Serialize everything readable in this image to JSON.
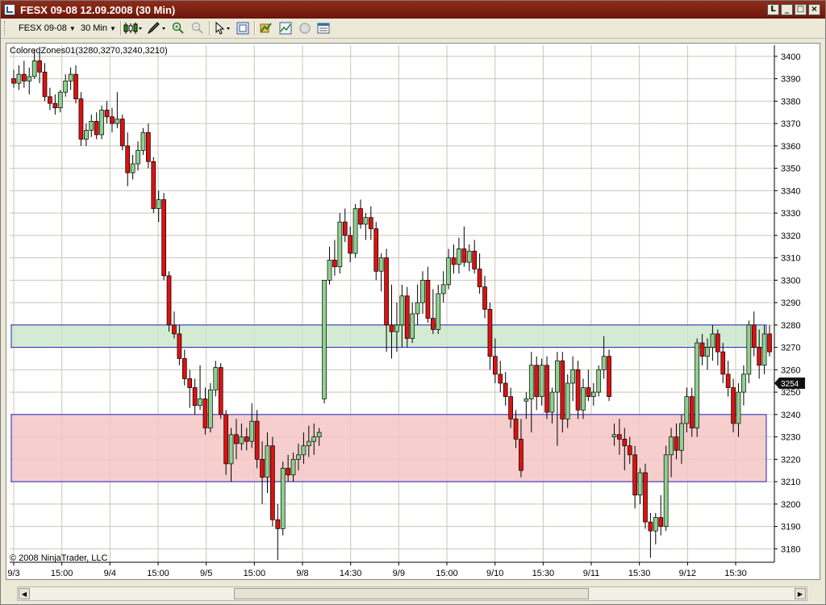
{
  "window": {
    "title": "FESX 09-08  12.09.2008 (30 Min)"
  },
  "toolbar": {
    "instrument": "FESX 09-08",
    "interval": "30 Min"
  },
  "chart": {
    "indicator_label": "ColoredZones01(3280,3270,3240,3210)",
    "copyright": "© 2008 NinjaTrader, LLC",
    "last_price_label": "3254",
    "colors": {
      "up_body": "#8fd18f",
      "down_body": "#dd1111",
      "upper_zone_fill": "#cbe8cb",
      "lower_zone_fill": "#f5c6c6",
      "zone_border": "#2222bb",
      "gridline": "#c9c4b4"
    }
  },
  "chart_data": {
    "type": "candlestick",
    "title": "",
    "ylim": [
      3174,
      3405
    ],
    "y_ticks": [
      3180,
      3190,
      3200,
      3210,
      3220,
      3230,
      3240,
      3250,
      3260,
      3270,
      3280,
      3290,
      3300,
      3310,
      3320,
      3330,
      3340,
      3350,
      3360,
      3370,
      3380,
      3390,
      3400
    ],
    "x_tick_labels": [
      "9/3",
      "15:00",
      "9/4",
      "15:00",
      "9/5",
      "15:00",
      "9/8",
      "14:30",
      "9/9",
      "15:00",
      "9/10",
      "15:30",
      "9/11",
      "15:30",
      "9/12",
      "15:30"
    ],
    "zones": [
      {
        "high": 3280,
        "low": 3270
      },
      {
        "high": 3240,
        "low": 3210
      }
    ],
    "last_price": 3254,
    "candles": [
      {
        "o": 3390,
        "h": 3394,
        "l": 3386,
        "c": 3388
      },
      {
        "o": 3388,
        "h": 3396,
        "l": 3385,
        "c": 3392
      },
      {
        "o": 3392,
        "h": 3398,
        "l": 3386,
        "c": 3389
      },
      {
        "o": 3389,
        "h": 3395,
        "l": 3383,
        "c": 3391
      },
      {
        "o": 3391,
        "h": 3403,
        "l": 3390,
        "c": 3398
      },
      {
        "o": 3398,
        "h": 3402,
        "l": 3388,
        "c": 3393
      },
      {
        "o": 3393,
        "h": 3397,
        "l": 3380,
        "c": 3382
      },
      {
        "o": 3382,
        "h": 3386,
        "l": 3376,
        "c": 3379
      },
      {
        "o": 3379,
        "h": 3383,
        "l": 3374,
        "c": 3377
      },
      {
        "o": 3377,
        "h": 3385,
        "l": 3375,
        "c": 3384
      },
      {
        "o": 3384,
        "h": 3392,
        "l": 3382,
        "c": 3389
      },
      {
        "o": 3389,
        "h": 3395,
        "l": 3385,
        "c": 3392
      },
      {
        "o": 3392,
        "h": 3396,
        "l": 3379,
        "c": 3381
      },
      {
        "o": 3381,
        "h": 3384,
        "l": 3360,
        "c": 3363
      },
      {
        "o": 3363,
        "h": 3370,
        "l": 3360,
        "c": 3367
      },
      {
        "o": 3367,
        "h": 3374,
        "l": 3364,
        "c": 3371
      },
      {
        "o": 3371,
        "h": 3375,
        "l": 3363,
        "c": 3365
      },
      {
        "o": 3365,
        "h": 3378,
        "l": 3363,
        "c": 3376
      },
      {
        "o": 3376,
        "h": 3380,
        "l": 3370,
        "c": 3373
      },
      {
        "o": 3373,
        "h": 3377,
        "l": 3366,
        "c": 3370
      },
      {
        "o": 3370,
        "h": 3384,
        "l": 3368,
        "c": 3372
      },
      {
        "o": 3372,
        "h": 3374,
        "l": 3358,
        "c": 3360
      },
      {
        "o": 3360,
        "h": 3366,
        "l": 3342,
        "c": 3348
      },
      {
        "o": 3348,
        "h": 3356,
        "l": 3345,
        "c": 3352
      },
      {
        "o": 3352,
        "h": 3362,
        "l": 3349,
        "c": 3358
      },
      {
        "o": 3358,
        "h": 3368,
        "l": 3356,
        "c": 3366
      },
      {
        "o": 3366,
        "h": 3370,
        "l": 3350,
        "c": 3353
      },
      {
        "o": 3353,
        "h": 3355,
        "l": 3330,
        "c": 3332
      },
      {
        "o": 3332,
        "h": 3340,
        "l": 3326,
        "c": 3336
      },
      {
        "o": 3336,
        "h": 3339,
        "l": 3300,
        "c": 3302
      },
      {
        "o": 3302,
        "h": 3304,
        "l": 3277,
        "c": 3280
      },
      {
        "o": 3280,
        "h": 3286,
        "l": 3274,
        "c": 3276
      },
      {
        "o": 3276,
        "h": 3280,
        "l": 3262,
        "c": 3265
      },
      {
        "o": 3265,
        "h": 3269,
        "l": 3253,
        "c": 3256
      },
      {
        "o": 3256,
        "h": 3260,
        "l": 3243,
        "c": 3252
      },
      {
        "o": 3252,
        "h": 3256,
        "l": 3240,
        "c": 3244
      },
      {
        "o": 3244,
        "h": 3262,
        "l": 3242,
        "c": 3247
      },
      {
        "o": 3247,
        "h": 3252,
        "l": 3231,
        "c": 3234
      },
      {
        "o": 3234,
        "h": 3254,
        "l": 3232,
        "c": 3251
      },
      {
        "o": 3251,
        "h": 3264,
        "l": 3248,
        "c": 3261
      },
      {
        "o": 3261,
        "h": 3263,
        "l": 3238,
        "c": 3240
      },
      {
        "o": 3240,
        "h": 3242,
        "l": 3213,
        "c": 3218
      },
      {
        "o": 3218,
        "h": 3234,
        "l": 3210,
        "c": 3231
      },
      {
        "o": 3231,
        "h": 3238,
        "l": 3220,
        "c": 3227
      },
      {
        "o": 3227,
        "h": 3236,
        "l": 3224,
        "c": 3230
      },
      {
        "o": 3230,
        "h": 3234,
        "l": 3224,
        "c": 3228
      },
      {
        "o": 3228,
        "h": 3245,
        "l": 3225,
        "c": 3237
      },
      {
        "o": 3237,
        "h": 3242,
        "l": 3216,
        "c": 3220
      },
      {
        "o": 3220,
        "h": 3228,
        "l": 3200,
        "c": 3212
      },
      {
        "o": 3212,
        "h": 3232,
        "l": 3205,
        "c": 3226
      },
      {
        "o": 3226,
        "h": 3230,
        "l": 3190,
        "c": 3193
      },
      {
        "o": 3193,
        "h": 3200,
        "l": 3175,
        "c": 3189
      },
      {
        "o": 3189,
        "h": 3219,
        "l": 3186,
        "c": 3216
      },
      {
        "o": 3216,
        "h": 3222,
        "l": 3210,
        "c": 3213
      },
      {
        "o": 3213,
        "h": 3223,
        "l": 3210,
        "c": 3220
      },
      {
        "o": 3220,
        "h": 3227,
        "l": 3215,
        "c": 3222
      },
      {
        "o": 3222,
        "h": 3232,
        "l": 3218,
        "c": 3226
      },
      {
        "o": 3226,
        "h": 3235,
        "l": 3221,
        "c": 3228
      },
      {
        "o": 3228,
        "h": 3236,
        "l": 3222,
        "c": 3230
      },
      {
        "o": 3230,
        "h": 3234,
        "l": 3226,
        "c": 3232
      },
      {
        "o": 3247,
        "h": 3300,
        "l": 3245,
        "c": 3300
      },
      {
        "o": 3300,
        "h": 3315,
        "l": 3298,
        "c": 3309
      },
      {
        "o": 3309,
        "h": 3318,
        "l": 3302,
        "c": 3306
      },
      {
        "o": 3306,
        "h": 3330,
        "l": 3303,
        "c": 3326
      },
      {
        "o": 3326,
        "h": 3332,
        "l": 3317,
        "c": 3320
      },
      {
        "o": 3320,
        "h": 3324,
        "l": 3308,
        "c": 3312
      },
      {
        "o": 3312,
        "h": 3334,
        "l": 3310,
        "c": 3332
      },
      {
        "o": 3332,
        "h": 3336,
        "l": 3323,
        "c": 3325
      },
      {
        "o": 3325,
        "h": 3330,
        "l": 3318,
        "c": 3328
      },
      {
        "o": 3328,
        "h": 3333,
        "l": 3318,
        "c": 3323
      },
      {
        "o": 3323,
        "h": 3326,
        "l": 3300,
        "c": 3304
      },
      {
        "o": 3304,
        "h": 3312,
        "l": 3295,
        "c": 3310
      },
      {
        "o": 3310,
        "h": 3314,
        "l": 3268,
        "c": 3280
      },
      {
        "o": 3280,
        "h": 3298,
        "l": 3265,
        "c": 3277
      },
      {
        "o": 3277,
        "h": 3290,
        "l": 3268,
        "c": 3280
      },
      {
        "o": 3280,
        "h": 3298,
        "l": 3270,
        "c": 3293
      },
      {
        "o": 3293,
        "h": 3297,
        "l": 3270,
        "c": 3274
      },
      {
        "o": 3274,
        "h": 3290,
        "l": 3272,
        "c": 3285
      },
      {
        "o": 3285,
        "h": 3298,
        "l": 3280,
        "c": 3290
      },
      {
        "o": 3290,
        "h": 3304,
        "l": 3285,
        "c": 3300
      },
      {
        "o": 3300,
        "h": 3306,
        "l": 3281,
        "c": 3283
      },
      {
        "o": 3283,
        "h": 3296,
        "l": 3276,
        "c": 3278
      },
      {
        "o": 3278,
        "h": 3298,
        "l": 3276,
        "c": 3294
      },
      {
        "o": 3294,
        "h": 3304,
        "l": 3290,
        "c": 3298
      },
      {
        "o": 3298,
        "h": 3314,
        "l": 3296,
        "c": 3310
      },
      {
        "o": 3310,
        "h": 3316,
        "l": 3303,
        "c": 3307
      },
      {
        "o": 3307,
        "h": 3319,
        "l": 3303,
        "c": 3314
      },
      {
        "o": 3314,
        "h": 3324,
        "l": 3306,
        "c": 3308
      },
      {
        "o": 3308,
        "h": 3316,
        "l": 3304,
        "c": 3313
      },
      {
        "o": 3313,
        "h": 3318,
        "l": 3303,
        "c": 3305
      },
      {
        "o": 3305,
        "h": 3312,
        "l": 3294,
        "c": 3297
      },
      {
        "o": 3297,
        "h": 3302,
        "l": 3283,
        "c": 3287
      },
      {
        "o": 3287,
        "h": 3290,
        "l": 3260,
        "c": 3266
      },
      {
        "o": 3266,
        "h": 3274,
        "l": 3254,
        "c": 3258
      },
      {
        "o": 3258,
        "h": 3264,
        "l": 3250,
        "c": 3254
      },
      {
        "o": 3254,
        "h": 3259,
        "l": 3244,
        "c": 3248
      },
      {
        "o": 3248,
        "h": 3252,
        "l": 3234,
        "c": 3238
      },
      {
        "o": 3238,
        "h": 3242,
        "l": 3225,
        "c": 3229
      },
      {
        "o": 3229,
        "h": 3238,
        "l": 3212,
        "c": 3215
      },
      {
        "o": 3246,
        "h": 3250,
        "l": 3238,
        "c": 3247
      },
      {
        "o": 3247,
        "h": 3268,
        "l": 3232,
        "c": 3262
      },
      {
        "o": 3262,
        "h": 3266,
        "l": 3242,
        "c": 3248
      },
      {
        "o": 3248,
        "h": 3265,
        "l": 3244,
        "c": 3262
      },
      {
        "o": 3262,
        "h": 3266,
        "l": 3238,
        "c": 3241
      },
      {
        "o": 3241,
        "h": 3252,
        "l": 3236,
        "c": 3250
      },
      {
        "o": 3250,
        "h": 3268,
        "l": 3226,
        "c": 3264
      },
      {
        "o": 3264,
        "h": 3268,
        "l": 3232,
        "c": 3238
      },
      {
        "o": 3238,
        "h": 3258,
        "l": 3234,
        "c": 3254
      },
      {
        "o": 3254,
        "h": 3266,
        "l": 3246,
        "c": 3260
      },
      {
        "o": 3260,
        "h": 3264,
        "l": 3238,
        "c": 3242
      },
      {
        "o": 3242,
        "h": 3256,
        "l": 3238,
        "c": 3252
      },
      {
        "o": 3252,
        "h": 3260,
        "l": 3246,
        "c": 3248
      },
      {
        "o": 3248,
        "h": 3254,
        "l": 3244,
        "c": 3250
      },
      {
        "o": 3250,
        "h": 3262,
        "l": 3248,
        "c": 3260
      },
      {
        "o": 3260,
        "h": 3275,
        "l": 3256,
        "c": 3266
      },
      {
        "o": 3266,
        "h": 3269,
        "l": 3246,
        "c": 3248
      },
      {
        "o": 3230,
        "h": 3236,
        "l": 3226,
        "c": 3231
      },
      {
        "o": 3231,
        "h": 3238,
        "l": 3222,
        "c": 3229
      },
      {
        "o": 3229,
        "h": 3234,
        "l": 3215,
        "c": 3226
      },
      {
        "o": 3226,
        "h": 3230,
        "l": 3218,
        "c": 3222
      },
      {
        "o": 3222,
        "h": 3226,
        "l": 3198,
        "c": 3204
      },
      {
        "o": 3204,
        "h": 3216,
        "l": 3200,
        "c": 3214
      },
      {
        "o": 3214,
        "h": 3218,
        "l": 3189,
        "c": 3192
      },
      {
        "o": 3192,
        "h": 3196,
        "l": 3176,
        "c": 3188
      },
      {
        "o": 3188,
        "h": 3196,
        "l": 3182,
        "c": 3194
      },
      {
        "o": 3194,
        "h": 3204,
        "l": 3186,
        "c": 3190
      },
      {
        "o": 3190,
        "h": 3226,
        "l": 3188,
        "c": 3222
      },
      {
        "o": 3222,
        "h": 3234,
        "l": 3212,
        "c": 3230
      },
      {
        "o": 3230,
        "h": 3236,
        "l": 3220,
        "c": 3224
      },
      {
        "o": 3224,
        "h": 3240,
        "l": 3218,
        "c": 3236
      },
      {
        "o": 3236,
        "h": 3252,
        "l": 3232,
        "c": 3248
      },
      {
        "o": 3248,
        "h": 3252,
        "l": 3230,
        "c": 3234
      },
      {
        "o": 3234,
        "h": 3274,
        "l": 3230,
        "c": 3272
      },
      {
        "o": 3272,
        "h": 3276,
        "l": 3262,
        "c": 3266
      },
      {
        "o": 3266,
        "h": 3274,
        "l": 3260,
        "c": 3270
      },
      {
        "o": 3270,
        "h": 3280,
        "l": 3264,
        "c": 3276
      },
      {
        "o": 3276,
        "h": 3278,
        "l": 3262,
        "c": 3268
      },
      {
        "o": 3268,
        "h": 3272,
        "l": 3254,
        "c": 3258
      },
      {
        "o": 3258,
        "h": 3264,
        "l": 3248,
        "c": 3252
      },
      {
        "o": 3252,
        "h": 3256,
        "l": 3232,
        "c": 3236
      },
      {
        "o": 3236,
        "h": 3254,
        "l": 3230,
        "c": 3250
      },
      {
        "o": 3250,
        "h": 3262,
        "l": 3244,
        "c": 3258
      },
      {
        "o": 3258,
        "h": 3282,
        "l": 3254,
        "c": 3280
      },
      {
        "o": 3280,
        "h": 3286,
        "l": 3266,
        "c": 3270
      },
      {
        "o": 3270,
        "h": 3278,
        "l": 3256,
        "c": 3262
      },
      {
        "o": 3262,
        "h": 3280,
        "l": 3258,
        "c": 3276
      },
      {
        "o": 3276,
        "h": 3280,
        "l": 3266,
        "c": 3268
      }
    ]
  }
}
